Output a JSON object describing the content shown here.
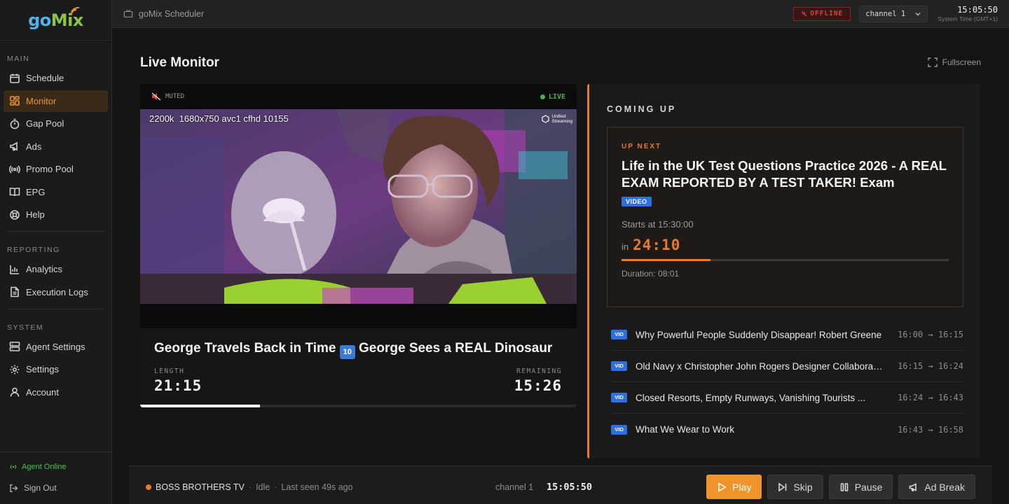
{
  "app": {
    "logo_go": "go",
    "logo_mix": "Mix",
    "window_title": "goMix Scheduler"
  },
  "sidebar": {
    "sections": [
      {
        "title": "MAIN",
        "items": [
          {
            "label": "Schedule",
            "icon": "calendar-icon"
          },
          {
            "label": "Monitor",
            "icon": "grid-icon",
            "active": true
          },
          {
            "label": "Gap Pool",
            "icon": "timer-icon"
          },
          {
            "label": "Ads",
            "icon": "megaphone-icon"
          },
          {
            "label": "Promo Pool",
            "icon": "broadcast-icon"
          },
          {
            "label": "EPG",
            "icon": "book-icon"
          },
          {
            "label": "Help",
            "icon": "lifebuoy-icon"
          }
        ]
      },
      {
        "title": "REPORTING",
        "items": [
          {
            "label": "Analytics",
            "icon": "bar-chart-icon"
          },
          {
            "label": "Execution Logs",
            "icon": "file-text-icon"
          }
        ]
      },
      {
        "title": "SYSTEM",
        "items": [
          {
            "label": "Agent Settings",
            "icon": "server-icon"
          },
          {
            "label": "Settings",
            "icon": "gear-icon"
          },
          {
            "label": "Account",
            "icon": "user-icon"
          }
        ]
      }
    ],
    "agent_status": "Agent Online",
    "sign_out": "Sign Out"
  },
  "topbar": {
    "status_badge": "OFFLINE",
    "channel": "channel 1",
    "system_time": "15:05:50",
    "system_time_label": "System Time (GMT+1)"
  },
  "main": {
    "title": "Live Monitor",
    "fullscreen": "Fullscreen"
  },
  "player": {
    "muted": "MUTED",
    "live": "LIVE",
    "stream_info": "2200k  1680x750 avc1 cfhd 10155",
    "watermark_line1": "Unified",
    "watermark_line2": "Streaming",
    "now_title_part1": "George Travels Back in Time",
    "now_title_emoji": "🔟",
    "now_title_part2": "George Sees a REAL Dinosaur",
    "length_label": "LENGTH",
    "length": "21:15",
    "remaining_label": "REMAINING",
    "remaining": "15:26",
    "progress": 0.274
  },
  "coming_up": {
    "title": "COMING UP",
    "up_next_label": "UP NEXT",
    "up_next_title": "Life in the UK Test Questions Practice 2026 - A REAL EXAM REPORTED BY A TEST TAKER! Exam",
    "up_next_badge": "VIDEO",
    "starts": "Starts at 15:30:00",
    "in_label": "in",
    "countdown": "24:10",
    "countdown_progress": 0.273,
    "duration": "Duration: 08:01",
    "queue": [
      {
        "badge": "VID",
        "title": "Why Powerful People Suddenly Disappear! Robert Greene",
        "time": "16:00 → 16:15"
      },
      {
        "badge": "VID",
        "title": "Old Navy x Christopher John Rogers Designer Collaboration",
        "time": "16:15 → 16:24"
      },
      {
        "badge": "VID",
        "title": "Closed Resorts, Empty Runways, Vanishing Tourists ...",
        "time": "16:24 → 16:43"
      },
      {
        "badge": "VID",
        "title": "What We Wear to Work",
        "time": "16:43 → 16:58"
      }
    ]
  },
  "bottombar": {
    "channel_name": "BOSS BROTHERS TV",
    "state": "Idle",
    "last_seen": "Last seen 49s ago",
    "channel": "channel 1",
    "time": "15:05:50",
    "buttons": {
      "play": "Play",
      "skip": "Skip",
      "pause": "Pause",
      "ad_break": "Ad Break"
    }
  },
  "colors": {
    "accent": "#f0932b",
    "live": "#4caf50",
    "offline": "#d9443a",
    "badge": "#2f6fe0"
  }
}
